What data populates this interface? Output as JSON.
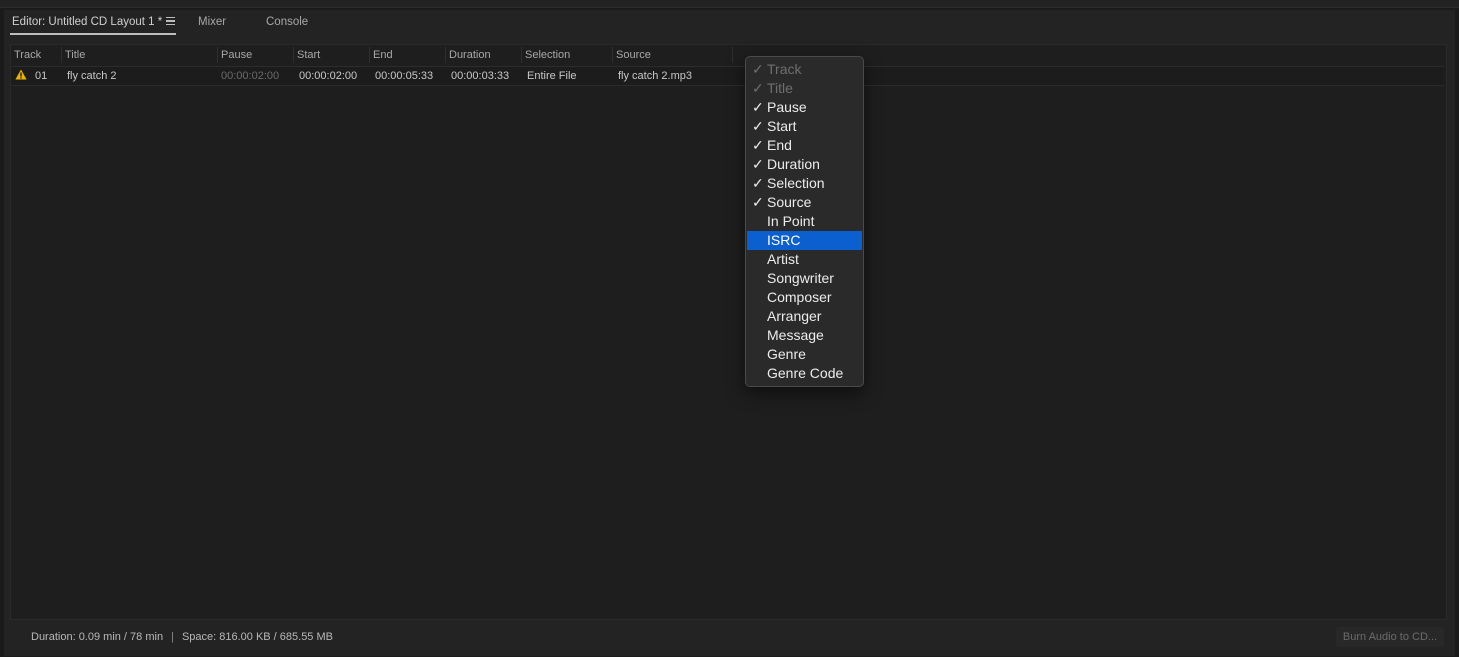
{
  "tabs": [
    {
      "label": "Editor: Untitled CD Layout 1 *"
    },
    {
      "label": "Mixer"
    },
    {
      "label": "Console"
    }
  ],
  "table": {
    "headers": [
      "Track",
      "Title",
      "Pause",
      "Start",
      "End",
      "Duration",
      "Selection",
      "Source"
    ],
    "rows": [
      {
        "track": "01",
        "title": "fly catch 2",
        "pause": "00:00:02:00",
        "start": "00:00:02:00",
        "end": "00:00:05:33",
        "duration": "00:00:03:33",
        "selection": "Entire File",
        "source": "fly catch 2.mp3",
        "warning_icon": "warning-triangle-icon"
      }
    ]
  },
  "context_menu": {
    "items": [
      {
        "label": "Track",
        "checked": true,
        "disabled": true
      },
      {
        "label": "Title",
        "checked": true,
        "disabled": true
      },
      {
        "label": "Pause",
        "checked": true
      },
      {
        "label": "Start",
        "checked": true
      },
      {
        "label": "End",
        "checked": true
      },
      {
        "label": "Duration",
        "checked": true
      },
      {
        "label": "Selection",
        "checked": true
      },
      {
        "label": "Source",
        "checked": true
      },
      {
        "label": "In Point",
        "checked": false
      },
      {
        "label": "ISRC",
        "checked": false,
        "highlighted": true
      },
      {
        "label": "Artist",
        "checked": false
      },
      {
        "label": "Songwriter",
        "checked": false
      },
      {
        "label": "Composer",
        "checked": false
      },
      {
        "label": "Arranger",
        "checked": false
      },
      {
        "label": "Message",
        "checked": false
      },
      {
        "label": "Genre",
        "checked": false
      },
      {
        "label": "Genre Code",
        "checked": false
      }
    ],
    "check_glyph": "✓"
  },
  "status": {
    "duration": "Duration: 0.09 min / 78 min",
    "separator": "|",
    "space": "Space: 816.00 KB / 685.55 MB"
  },
  "burn_button": {
    "label": "Burn Audio to CD..."
  },
  "colors": {
    "highlight": "#0b5fcf",
    "warning": "#e8b400",
    "background": "#1a1a1a"
  }
}
